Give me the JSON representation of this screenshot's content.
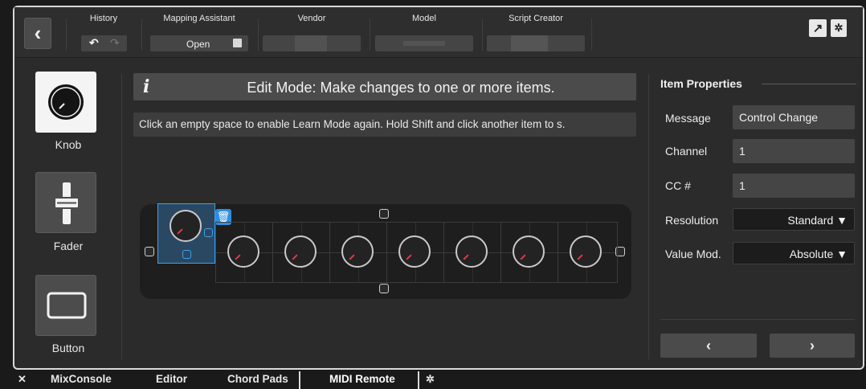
{
  "toolbar": {
    "history_label": "History",
    "mapping_label": "Mapping Assistant",
    "mapping_value": "Open",
    "vendor_label": "Vendor",
    "model_label": "Model",
    "script_label": "Script Creator"
  },
  "palette": {
    "items": [
      {
        "label": "Knob"
      },
      {
        "label": "Fader"
      },
      {
        "label": "Button"
      }
    ]
  },
  "info": {
    "title": "Edit Mode: Make changes to one or more items.",
    "hint": "Click an empty space to enable Learn Mode again. Hold Shift and click another item to s."
  },
  "properties": {
    "title": "Item Properties",
    "rows": [
      {
        "label": "Message",
        "value": "Control Change"
      },
      {
        "label": "Channel",
        "value": "1"
      },
      {
        "label": "CC #",
        "value": "1"
      },
      {
        "label": "Resolution",
        "value": "Standard ▼"
      },
      {
        "label": "Value Mod.",
        "value": "Absolute ▼"
      }
    ]
  },
  "tabs": {
    "close": "✕",
    "items": [
      "MixConsole",
      "Editor",
      "Chord Pads",
      "MIDI Remote"
    ]
  },
  "colors": {
    "accent": "#3aa3f0",
    "knob_indicator": "#e23a4a"
  }
}
